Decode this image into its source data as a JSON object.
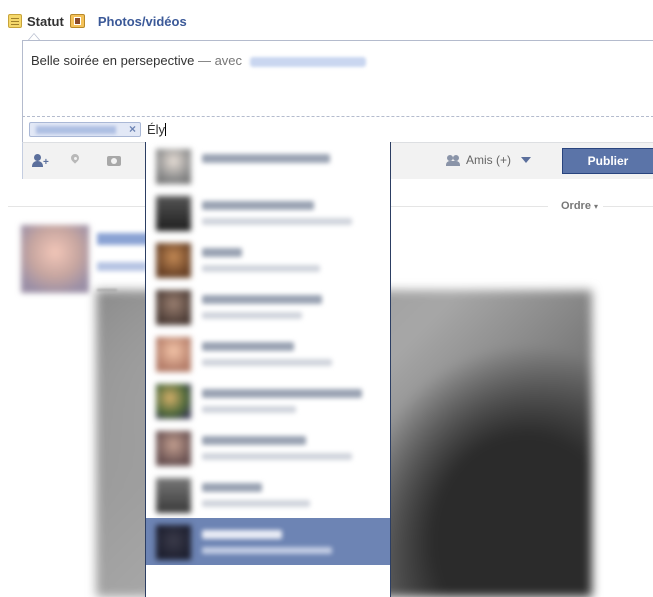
{
  "tabs": {
    "status_label": "Statut",
    "photos_label": "Photos/vidéos"
  },
  "composer": {
    "text": "Belle soirée en persepective",
    "dash": "—",
    "with_label": "avec"
  },
  "tag_field": {
    "token_remove": "×",
    "typed_value": "Ély"
  },
  "actions": {
    "audience_label": "Amis (+)",
    "publish_label": "Publier"
  },
  "feed": {
    "sort_label": "Ordre",
    "sort_arrow": "▾"
  },
  "colors": {
    "link_blue": "#3b5998",
    "publish_bg": "#5b74a8",
    "selected_bg": "#6d84b4"
  },
  "suggestions": {
    "count": 9,
    "selected_index": 8
  }
}
